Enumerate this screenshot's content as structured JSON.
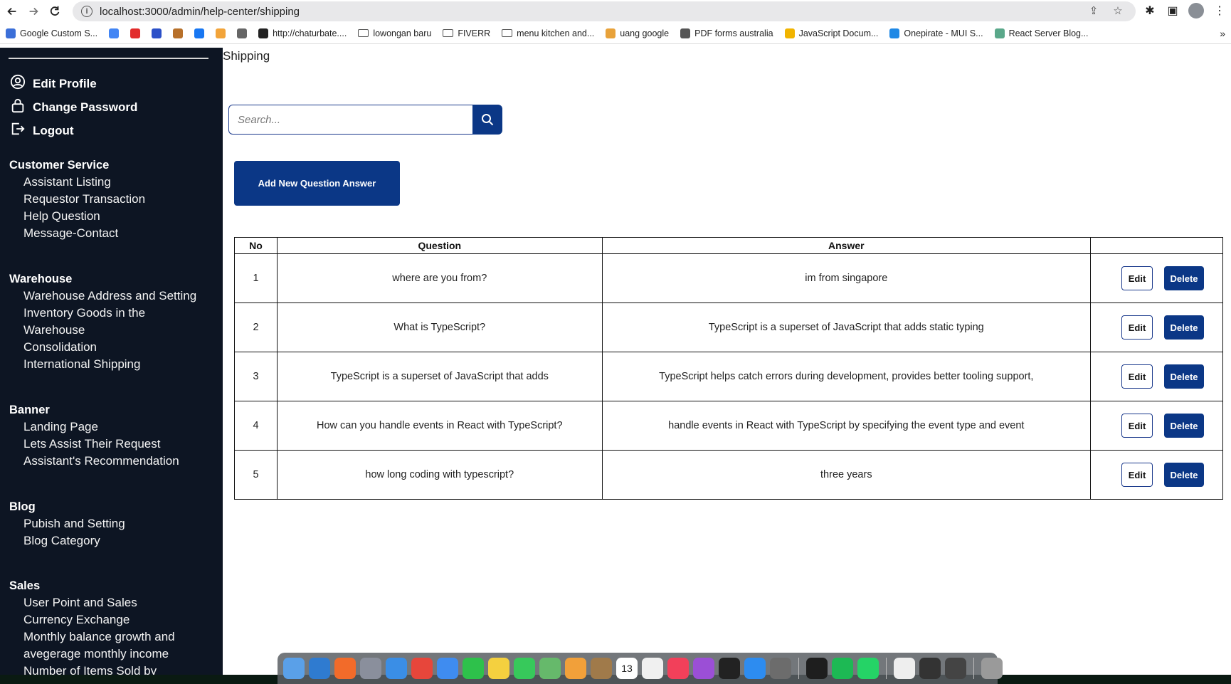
{
  "browser": {
    "url": "localhost:3000/admin/help-center/shipping",
    "bookmarks": [
      {
        "label": "Google Custom S...",
        "color": "#3b6fd8"
      },
      {
        "label": "",
        "color": "#4285f4"
      },
      {
        "label": "",
        "color": "#e22b2b"
      },
      {
        "label": "",
        "color": "#2b50c8"
      },
      {
        "label": "",
        "color": "#b7702a"
      },
      {
        "label": "",
        "color": "#1877f2"
      },
      {
        "label": "",
        "color": "#f2a43a"
      },
      {
        "label": "",
        "color": "#666666"
      },
      {
        "label": "http://chaturbate....",
        "color": "#222222"
      },
      {
        "label": "lowongan baru",
        "color": "folder"
      },
      {
        "label": "FIVERR",
        "color": "folder"
      },
      {
        "label": "menu kitchen and...",
        "color": "folder"
      },
      {
        "label": "uang google",
        "color": "#e8a23a"
      },
      {
        "label": "PDF forms australia",
        "color": "#555555"
      },
      {
        "label": "JavaScript Docum...",
        "color": "#f1b400"
      },
      {
        "label": "Onepirate - MUI S...",
        "color": "#1e88e5"
      },
      {
        "label": "React Server Blog...",
        "color": "#5aa88a"
      }
    ],
    "more_label": "»"
  },
  "sidebar": {
    "account": [
      {
        "label": "Edit Profile",
        "icon": "user-circle-icon"
      },
      {
        "label": "Change Password",
        "icon": "lock-icon"
      },
      {
        "label": "Logout",
        "icon": "logout-icon"
      }
    ],
    "sections": [
      {
        "title": "Customer Service",
        "items": [
          "Assistant Listing",
          "Requestor Transaction",
          "Help Question",
          "Message-Contact"
        ]
      },
      {
        "title": "Warehouse",
        "items": [
          "Warehouse Address and Setting",
          "Inventory Goods in the",
          "Warehouse",
          "Consolidation",
          "International Shipping"
        ]
      },
      {
        "title": "Banner",
        "items": [
          "Landing Page",
          "Lets Assist Their Request",
          "Assistant's Recommendation"
        ]
      },
      {
        "title": "Blog",
        "items": [
          "Pubish and Setting",
          "Blog Category"
        ]
      },
      {
        "title": "Sales",
        "items": [
          "User Point and Sales",
          "Currency Exchange",
          "Monthly balance growth and",
          "avegerage monthly income",
          "Number of Items Sold by"
        ]
      }
    ]
  },
  "main": {
    "title": "Shipping",
    "search_placeholder": "Search...",
    "add_button": "Add New Question Answer",
    "table": {
      "headers": {
        "no": "No",
        "question": "Question",
        "answer": "Answer",
        "actions": ""
      },
      "rows": [
        {
          "no": "1",
          "question": "where are you from?",
          "answer": "im from singapore"
        },
        {
          "no": "2",
          "question": "What is TypeScript?",
          "answer": "TypeScript is a superset of JavaScript that adds static typing"
        },
        {
          "no": "3",
          "question": "TypeScript is a superset of JavaScript that adds",
          "answer": "TypeScript helps catch errors during development, provides better tooling support,"
        },
        {
          "no": "4",
          "question": "How can you handle events in React with TypeScript?",
          "answer": "handle events in React with TypeScript by specifying the event type and event"
        },
        {
          "no": "5",
          "question": "how long coding with typescript?",
          "answer": "three years"
        }
      ],
      "edit_label": "Edit",
      "delete_label": "Delete"
    }
  },
  "dock": {
    "apps": [
      "finder",
      "vscode",
      "pencil",
      "launchpad",
      "safari",
      "chrome",
      "mail",
      "facetime",
      "notes",
      "messages",
      "maps",
      "photos",
      "contacts",
      "calendar",
      "reminders",
      "music",
      "podcasts",
      "tv",
      "app-store",
      "system-settings",
      "figma",
      "spotify",
      "whatsapp",
      "file",
      "window-1",
      "window-2",
      "trash"
    ],
    "colors": [
      "#5aa0e8",
      "#2f7bd0",
      "#f26b2a",
      "#8a8f9c",
      "#3a8ee6",
      "#e7463b",
      "#3f8cf0",
      "#2ec14b",
      "#f4d03f",
      "#37c95b",
      "#66b96b",
      "#f1a03a",
      "#a07a4a",
      "#ffffff",
      "#f0f0f0",
      "#f2405a",
      "#9b4fd6",
      "#222222",
      "#2d8cf0",
      "#6c6c6c",
      "#1e1e1e",
      "#1db954",
      "#25d366",
      "#eeeeee",
      "#333333",
      "#444444",
      "#9a9a9a"
    ],
    "calendar_day": "13"
  }
}
